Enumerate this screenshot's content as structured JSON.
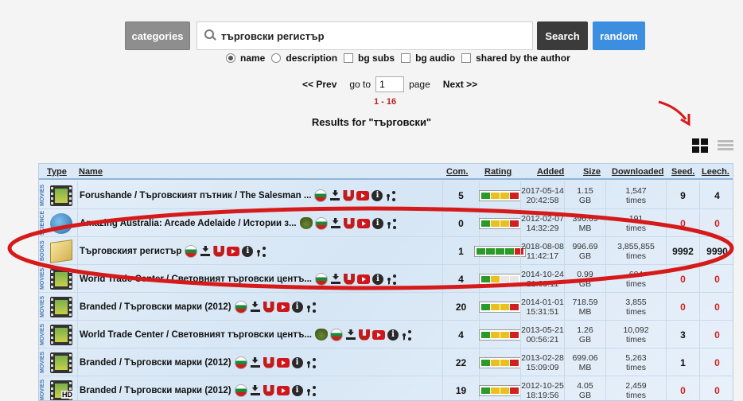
{
  "search": {
    "categories_label": "categories",
    "query": "търговски регистър",
    "search_label": "Search",
    "random_label": "random",
    "options": [
      {
        "label": "name",
        "type": "radio",
        "checked": true
      },
      {
        "label": "description",
        "type": "radio",
        "checked": false
      },
      {
        "label": "bg subs",
        "type": "checkbox",
        "checked": false
      },
      {
        "label": "bg audio",
        "type": "checkbox",
        "checked": false
      },
      {
        "label": "shared by the author",
        "type": "checkbox",
        "checked": false
      }
    ]
  },
  "pager": {
    "prev_label": "<< Prev",
    "goto_label": "go to",
    "page_value": "1",
    "page_label": "page",
    "next_label": "Next >>",
    "range": "1 - 16"
  },
  "results_title": "Results for \"търговски\"",
  "table": {
    "headers": {
      "type": "Type",
      "name": "Name",
      "com": "Com.",
      "rating": "Rating",
      "added": "Added",
      "size": "Size",
      "downloaded": "Downloaded",
      "seed": "Seed.",
      "leech": "Leech."
    },
    "rows": [
      {
        "category": "MOVIES",
        "icon": "film-icon",
        "name": "Forushande / Търговският пътник / The Salesman ...",
        "extra_icon": false,
        "com": "5",
        "rating": "gyyr",
        "date": "2017-05-14",
        "time": "20:42:58",
        "size1": "1.15",
        "size2": "GB",
        "dl1": "1,547",
        "dl2": "times",
        "seed": "9",
        "leech": "4"
      },
      {
        "category": "SCIENCE",
        "icon": "globe-icon",
        "name": "Amazing Australia: Arcade Adelaide / Истории з...",
        "extra_icon": true,
        "com": "0",
        "rating": "gyyr",
        "date": "2012-02-07",
        "time": "14:32:29",
        "size1": "396.69",
        "size2": "MB",
        "dl1": "191",
        "dl2": "times",
        "seed": "0",
        "leech": "0"
      },
      {
        "category": "BOOKS",
        "icon": "book-icon",
        "name": "Търговският регистър",
        "extra_icon": false,
        "com": "1",
        "rating": "ggggr",
        "date": "2018-08-08",
        "time": "11:42:17",
        "size1": "996.69",
        "size2": "GB",
        "dl1": "3,855,855",
        "dl2": "times",
        "seed": "9992",
        "leech": "9990"
      },
      {
        "category": "MOVIES",
        "icon": "film-icon",
        "name": "World Trade Center / Световният търговски центъ...",
        "extra_icon": false,
        "com": "4",
        "rating": "gyee",
        "date": "2014-10-24",
        "time": "21:03:11",
        "size1": "0.99",
        "size2": "GB",
        "dl1": "604",
        "dl2": "times",
        "seed": "0",
        "leech": "0"
      },
      {
        "category": "MOVIES",
        "icon": "film-icon",
        "name": "Branded / Търговски марки (2012)",
        "extra_icon": false,
        "com": "20",
        "rating": "gyyr",
        "date": "2014-01-01",
        "time": "15:31:51",
        "size1": "718.59",
        "size2": "MB",
        "dl1": "3,855",
        "dl2": "times",
        "seed": "0",
        "leech": "0"
      },
      {
        "category": "MOVIES",
        "icon": "film-icon",
        "name": "World Trade Center / Световният търговски центъ...",
        "extra_icon": true,
        "com": "4",
        "rating": "gyyr",
        "date": "2013-05-21",
        "time": "00:56:21",
        "size1": "1.26",
        "size2": "GB",
        "dl1": "10,092",
        "dl2": "times",
        "seed": "3",
        "leech": "0"
      },
      {
        "category": "MOVIES",
        "icon": "film-icon",
        "name": "Branded / Търговски марки (2012)",
        "extra_icon": false,
        "com": "22",
        "rating": "gyyr",
        "date": "2013-02-28",
        "time": "15:09:09",
        "size1": "699.06",
        "size2": "MB",
        "dl1": "5,263",
        "dl2": "times",
        "seed": "1",
        "leech": "0"
      },
      {
        "category": "MOVIES",
        "icon": "film-hd-icon",
        "name": "Branded / Търговски марки (2012)",
        "extra_icon": false,
        "com": "19",
        "rating": "gyyr",
        "date": "2012-10-25",
        "time": "18:19:56",
        "size1": "4.05",
        "size2": "GB",
        "dl1": "2,459",
        "dl2": "times",
        "seed": "0",
        "leech": "0"
      }
    ]
  },
  "colors": {
    "accent_blue": "#3c8ee0",
    "annotation_red": "#d61a1a",
    "zero_red": "#d02020"
  }
}
